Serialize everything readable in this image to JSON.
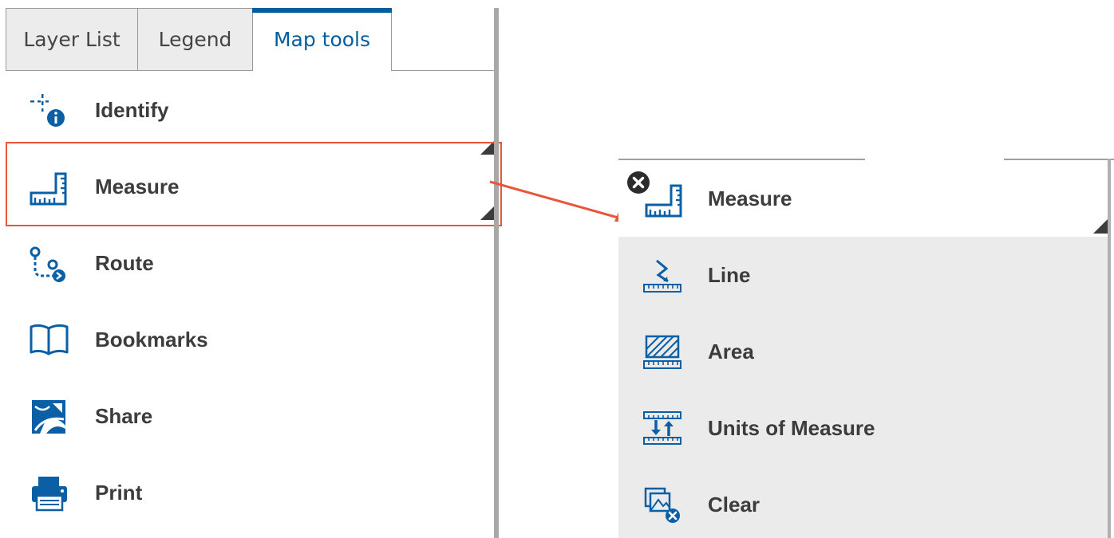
{
  "tabs": [
    {
      "label": "Layer List",
      "active": false
    },
    {
      "label": "Legend",
      "active": false
    },
    {
      "label": "Map tools",
      "active": true
    }
  ],
  "tools": [
    {
      "label": "Identify",
      "icon": "identify-icon",
      "has_flyout": true
    },
    {
      "label": "Measure",
      "icon": "measure-icon",
      "has_flyout": true,
      "highlighted": true
    },
    {
      "label": "Route",
      "icon": "route-icon"
    },
    {
      "label": "Bookmarks",
      "icon": "bookmarks-icon"
    },
    {
      "label": "Share",
      "icon": "share-icon"
    },
    {
      "label": "Print",
      "icon": "print-icon"
    }
  ],
  "measure_panel": {
    "title": "Measure",
    "close_icon": "close-icon",
    "icon": "measure-icon",
    "items": [
      {
        "label": "Line",
        "icon": "measure-line-icon"
      },
      {
        "label": "Area",
        "icon": "measure-area-icon"
      },
      {
        "label": "Units of Measure",
        "icon": "units-of-measure-icon"
      },
      {
        "label": "Clear",
        "icon": "clear-icon"
      }
    ]
  },
  "colors": {
    "accent": "#005e9e",
    "icon": "#0b5fa5",
    "highlight": "#e8553a",
    "panel_bg": "#ebebeb",
    "text": "#3c3c3c"
  }
}
